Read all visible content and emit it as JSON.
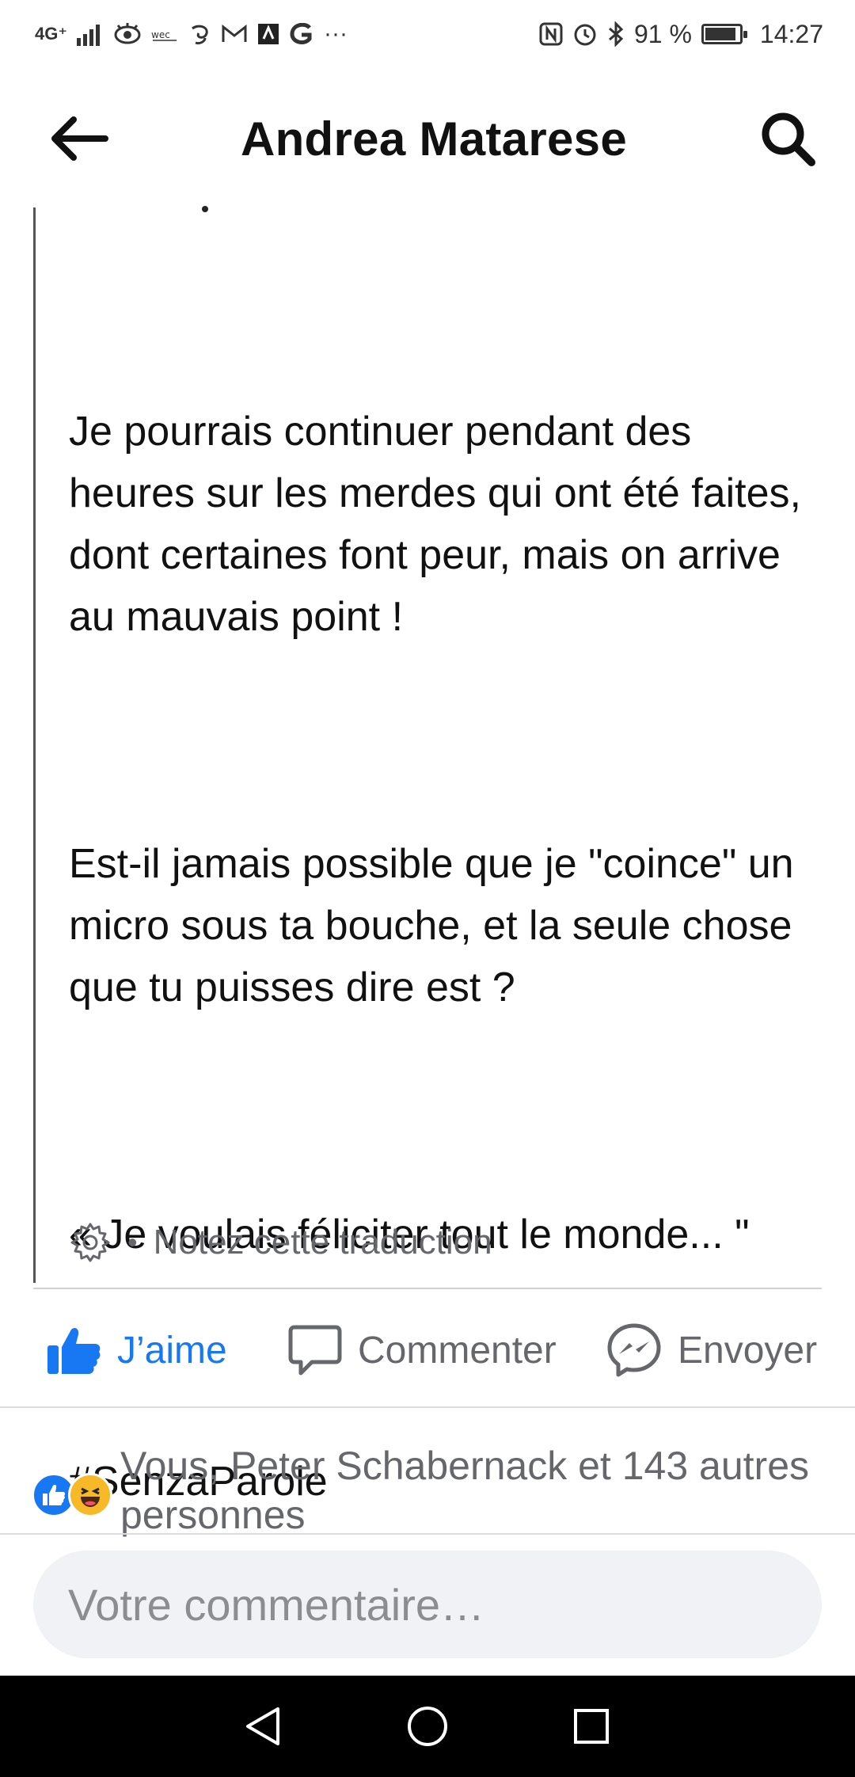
{
  "status_bar": {
    "network": "4G⁺",
    "battery_percent_text": "91 %",
    "battery_level": 0.91,
    "time": "14:27",
    "more_indicator": "···",
    "icons": [
      "signal-icon",
      "eye-icon",
      "wec-icon",
      "swirl-icon",
      "gmail-icon",
      "app-icon",
      "g-icon",
      "nfc-icon",
      "alarm-icon",
      "bluetooth-icon",
      "battery-icon"
    ]
  },
  "header": {
    "title": "Andrea Matarese",
    "back_icon": "back-arrow-icon",
    "search_icon": "search-icon"
  },
  "post": {
    "paragraphs": [
      "Je pourrais continuer pendant des heures sur les merdes qui ont été faites, dont certaines font peur, mais on arrive au mauvais point !",
      "Est-il jamais possible que je \"coince\" un micro sous ta bouche, et la seule chose que tu puisses dire est ?",
      "« Je voulais féliciter tout le monde... \"",
      "#SenzaParole"
    ],
    "translation_separator": "•",
    "translation_label": "Notez cette traduction"
  },
  "actions": {
    "like": "J’aime",
    "comment": "Commenter",
    "send": "Envoyer"
  },
  "reactions": {
    "text": "Vous, Peter Schabernack et 143 autres personnes"
  },
  "comment_input": {
    "placeholder": "Votre commentaire…"
  },
  "colors": {
    "accent": "#1877f2",
    "muted": "#65676b",
    "haha": "#f7b928"
  }
}
